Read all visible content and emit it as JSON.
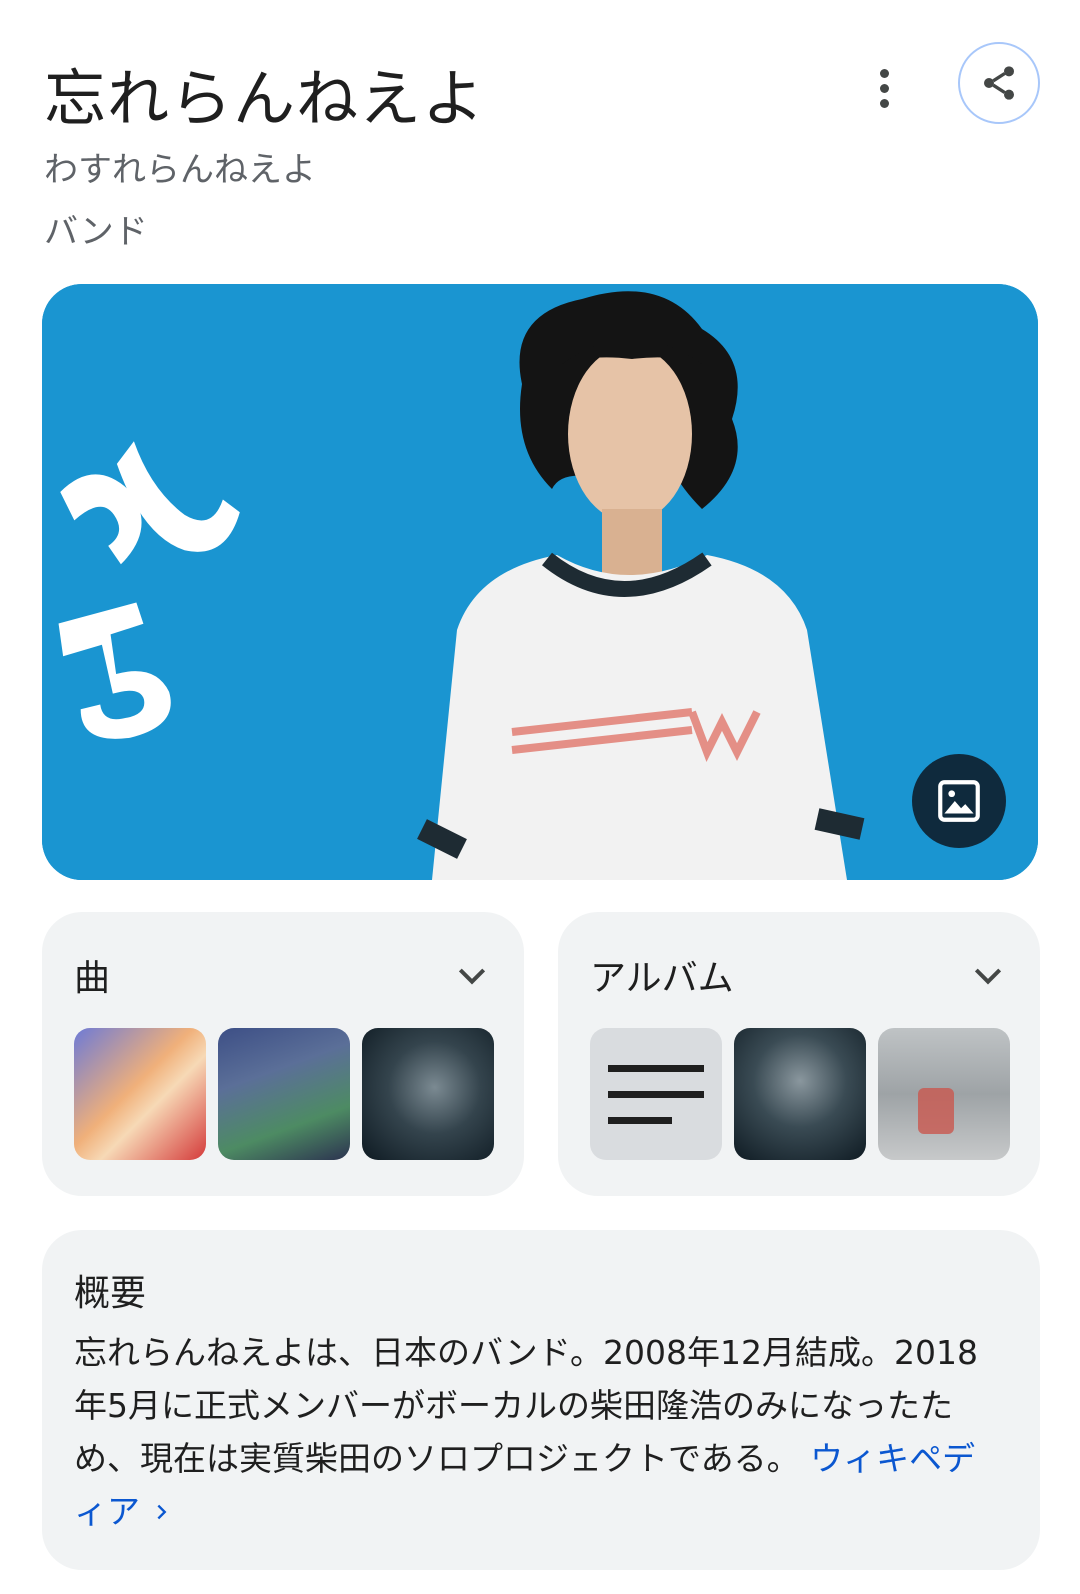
{
  "header": {
    "title": "忘れらんねえよ",
    "reading": "わすれらんねえよ",
    "type": "バンド"
  },
  "hero": {
    "background_color": "#1a95d1",
    "kana_text": "らん\nよ",
    "shirt_logo": "weezer"
  },
  "songs": {
    "title": "曲",
    "thumbnails": [
      "anime-boxer",
      "anime-characters",
      "singer-in-rain"
    ]
  },
  "albums": {
    "title": "アルバム",
    "thumbnails": [
      "placeholder-lines",
      "singer-in-rain",
      "street-photo"
    ]
  },
  "overview": {
    "title": "概要",
    "text": "忘れらんねえよは、日本のバンド。2008年12月結成。2018年5月に正式メンバーがボーカルの柴田隆浩のみになったため、現在は実質柴田のソロプロジェクトである。",
    "link_label": "ウィキペディア",
    "link_color": "#0b57d0"
  }
}
